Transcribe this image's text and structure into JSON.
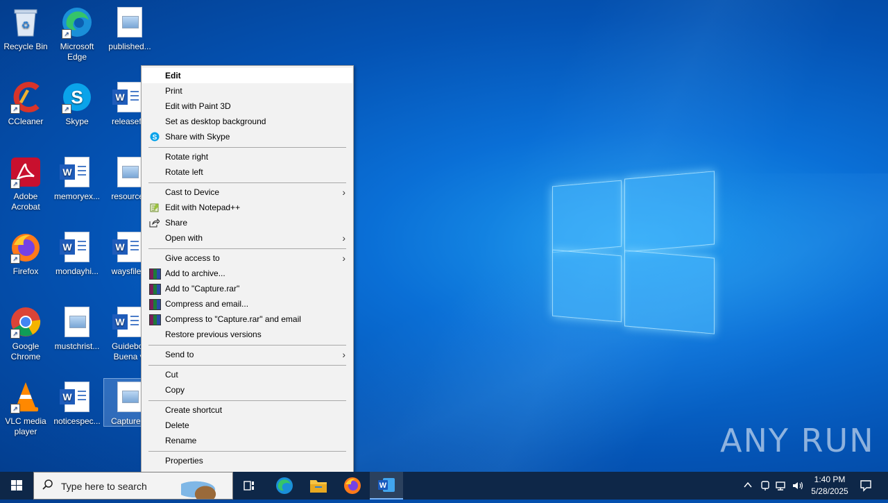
{
  "desktop": {
    "icons": [
      {
        "label": "Recycle Bin"
      },
      {
        "label": "Microsoft Edge"
      },
      {
        "label": "published..."
      },
      {
        "label": "CCleaner"
      },
      {
        "label": "Skype"
      },
      {
        "label": "releaseflo"
      },
      {
        "label": "Adobe Acrobat"
      },
      {
        "label": "memoryex..."
      },
      {
        "label": "resourceg"
      },
      {
        "label": "Firefox"
      },
      {
        "label": "mondayhi..."
      },
      {
        "label": "waysfile..."
      },
      {
        "label": "Google Chrome"
      },
      {
        "label": "mustchrist..."
      },
      {
        "label": "Guideboo Buena vi"
      },
      {
        "label": "VLC media player"
      },
      {
        "label": "noticespec..."
      },
      {
        "label": "Capture.P"
      }
    ]
  },
  "context_menu": {
    "items": [
      {
        "label": "Edit",
        "highlighted": true,
        "bold": true
      },
      {
        "label": "Print"
      },
      {
        "label": "Edit with Paint 3D"
      },
      {
        "label": "Set as desktop background"
      },
      {
        "label": "Share with Skype",
        "icon": "skype-icon"
      },
      {
        "label": "Rotate right"
      },
      {
        "label": "Rotate left"
      },
      {
        "label": "Cast to Device",
        "submenu": true
      },
      {
        "label": "Edit with Notepad++",
        "icon": "notepadpp-icon"
      },
      {
        "label": "Share",
        "icon": "share-icon"
      },
      {
        "label": "Open with",
        "submenu": true
      },
      {
        "label": "Give access to",
        "submenu": true
      },
      {
        "label": "Add to archive...",
        "icon": "winrar-icon"
      },
      {
        "label": "Add to \"Capture.rar\"",
        "icon": "winrar-icon"
      },
      {
        "label": "Compress and email...",
        "icon": "winrar-icon"
      },
      {
        "label": "Compress to \"Capture.rar\" and email",
        "icon": "winrar-icon"
      },
      {
        "label": "Restore previous versions"
      },
      {
        "label": "Send to",
        "submenu": true
      },
      {
        "label": "Cut"
      },
      {
        "label": "Copy"
      },
      {
        "label": "Create shortcut"
      },
      {
        "label": "Delete"
      },
      {
        "label": "Rename"
      },
      {
        "label": "Properties"
      }
    ],
    "submenu_arrow": "›"
  },
  "taskbar": {
    "search_placeholder": "Type here to search",
    "apps": [
      "task-view-icon",
      "edge-icon",
      "file-explorer-icon",
      "firefox-icon",
      "word-icon"
    ],
    "clock_time": "1:40 PM",
    "clock_date": "5/28/2025"
  },
  "watermark": "ANY RUN",
  "colors": {
    "desktop_blue": "#0a6fd6",
    "taskbar": "#0e2748",
    "menu_bg": "#f2f2f2"
  }
}
